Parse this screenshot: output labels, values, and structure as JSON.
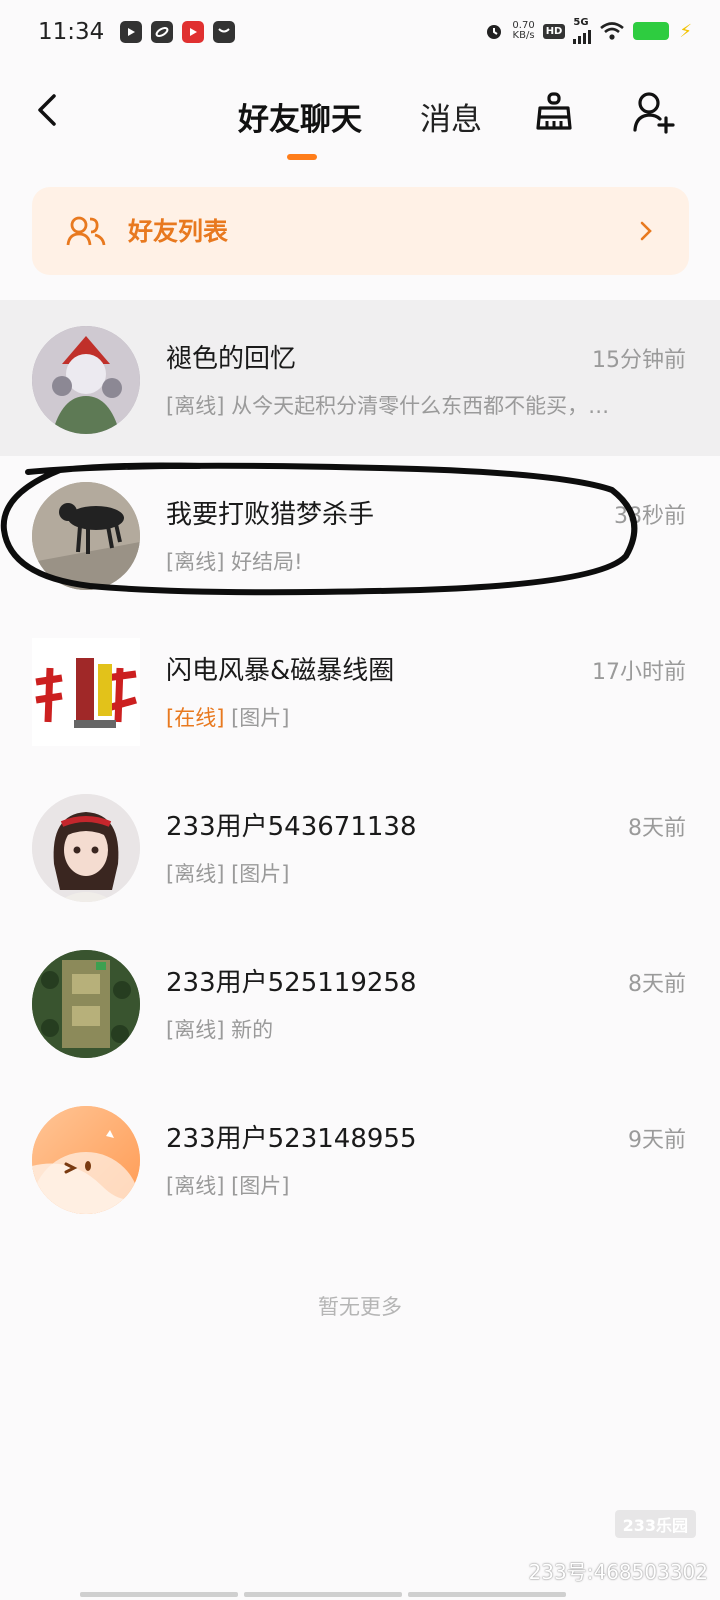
{
  "status_bar": {
    "time": "11:34",
    "net_speed_value": "0.70",
    "net_speed_unit": "KB/s",
    "hd_badge": "HD",
    "network": "5G"
  },
  "header": {
    "tab_friends_chat": "好友聊天",
    "tab_messages": "消息"
  },
  "friend_list_bar": {
    "label": "好友列表"
  },
  "chats": [
    {
      "name": "褪色的回忆",
      "time": "15分钟前",
      "status": "[离线]",
      "preview": "从今天起积分清零什么东西都不能买，…",
      "avatar_color": "#b0aab6"
    },
    {
      "name": "我要打败猎梦杀手",
      "time": "38秒前",
      "status": "[离线]",
      "preview": "好结局!",
      "avatar_color": "#a49c8e"
    },
    {
      "name": "闪电风暴&磁暴线圈",
      "time": "17小时前",
      "status": "[在线]",
      "preview": "[图片]",
      "avatar_color": "#ffffff"
    },
    {
      "name": "233用户543671138",
      "time": "8天前",
      "status": "[离线]",
      "preview": "[图片]",
      "avatar_color": "#e6e2e2"
    },
    {
      "name": "233用户525119258",
      "time": "8天前",
      "status": "[离线]",
      "preview": "新的",
      "avatar_color": "#3c5a32"
    },
    {
      "name": "233用户523148955",
      "time": "9天前",
      "status": "[离线]",
      "preview": "[图片]",
      "avatar_color": "#ffb780"
    }
  ],
  "footer": {
    "no_more": "暂无更多"
  },
  "watermark": {
    "logo": "233乐园",
    "id": "233号:468503302"
  },
  "colors": {
    "accent": "#ff7d1a",
    "accent_text": "#e8791f",
    "friend_bar_bg": "#fff1e6",
    "muted_text": "#9a9a9a"
  },
  "icons": {
    "back": "chevron-left-icon",
    "clean": "broom-icon",
    "add_friend": "add-user-icon",
    "friends": "people-icon",
    "chevron": "chevron-right-icon"
  }
}
